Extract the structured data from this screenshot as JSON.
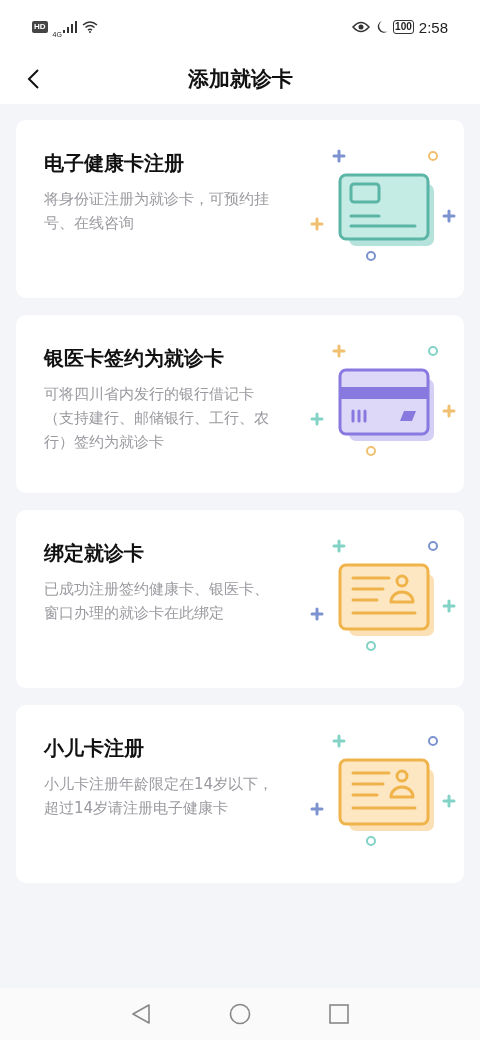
{
  "status_bar": {
    "hd": "HD",
    "network": "4G",
    "battery": "100",
    "time": "2:58"
  },
  "header": {
    "title": "添加就诊卡"
  },
  "cards": [
    {
      "kind": "id-card",
      "title": "电子健康卡注册",
      "description": "将身份证注册为就诊卡，可预约挂号、在线咨询"
    },
    {
      "kind": "bank-card",
      "title": "银医卡签约为就诊卡",
      "description": "可将四川省内发行的银行借记卡（支持建行、邮储银行、工行、农行）签约为就诊卡"
    },
    {
      "kind": "profile-card",
      "title": "绑定就诊卡",
      "description": "已成功注册签约健康卡、银医卡、窗口办理的就诊卡在此绑定"
    },
    {
      "kind": "profile-card",
      "title": "小儿卡注册",
      "description": "小儿卡注册年龄限定在14岁以下，超过14岁请注册电子健康卡"
    }
  ]
}
